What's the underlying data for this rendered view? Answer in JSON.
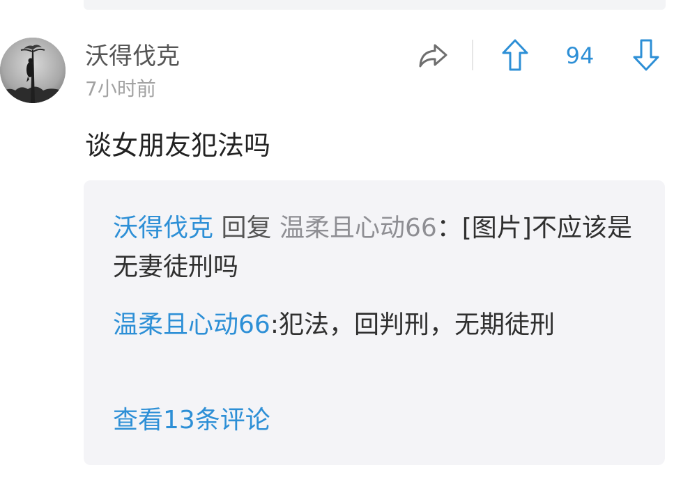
{
  "comment": {
    "author": "沃得伐克",
    "time": "7小时前",
    "text": "谈女朋友犯法吗",
    "vote_count": "94",
    "icons": {
      "share": "share-arrow-icon",
      "upvote": "arrow-up-icon",
      "downvote": "arrow-down-icon"
    }
  },
  "replies": [
    {
      "author": "沃得伐克",
      "reply_word": "回复",
      "reply_to": "温柔且心动66",
      "separator": "：",
      "text": "[图片]不应该是无妻徒刑吗"
    },
    {
      "author": "温柔且心动66",
      "separator": ":",
      "text": "犯法，回判刑，无期徒刑"
    }
  ],
  "view_more_label": "查看13条评论",
  "colors": {
    "accent": "#2d8fd6",
    "reply_background": "#f4f4f7",
    "username": "#555555",
    "timestamp": "#a2a2a2"
  }
}
